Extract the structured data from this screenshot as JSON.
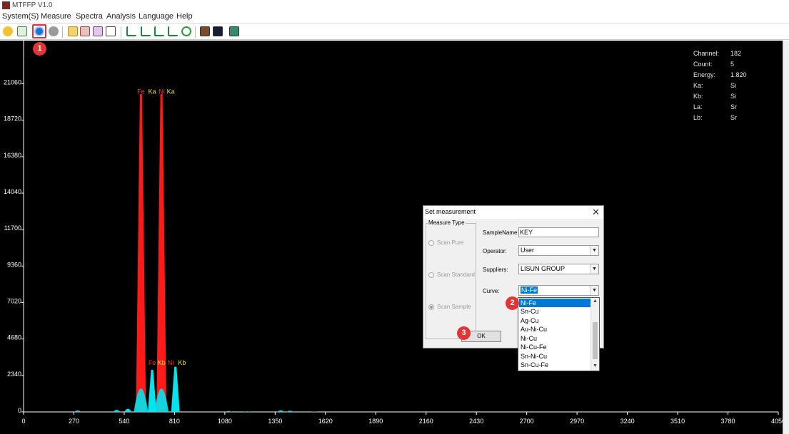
{
  "app": {
    "title": "MTFFP V1.0"
  },
  "menu": [
    "System(S)",
    "Measure",
    "Spectra",
    "Analysis",
    "Language",
    "Help"
  ],
  "toolbar_icons": [
    "smiley-icon",
    "move-icon",
    "start-measure-icon",
    "stop-icon",
    "open-folder-icon",
    "print-icon",
    "print-preview-icon",
    "report-icon",
    "peak-icon-1",
    "peak-icon-2",
    "peak-icon-3",
    "peak-icon-4",
    "refresh-icon",
    "palette-icon",
    "spectrum-view-icon",
    "export-icon"
  ],
  "badges": {
    "one": "1",
    "two": "2",
    "three": "3"
  },
  "chart_data": {
    "type": "line",
    "xlim": [
      0,
      4050
    ],
    "ylim": [
      0,
      22000
    ],
    "x_ticks": [
      0,
      270,
      540,
      810,
      1080,
      1350,
      1620,
      1890,
      2160,
      2430,
      2700,
      2970,
      3240,
      3510,
      3780,
      4050
    ],
    "y_ticks": [
      0,
      2340,
      4680,
      7020,
      9360,
      11700,
      14040,
      16380,
      18720,
      21060
    ],
    "peaks": [
      {
        "x": 630,
        "y": 20400,
        "color": "#ff1a1a"
      },
      {
        "x": 740,
        "y": 20400,
        "color": "#ff1a1a"
      },
      {
        "x": 690,
        "y": 2700,
        "color": "#00e5ee"
      },
      {
        "x": 815,
        "y": 2900,
        "color": "#00e5ee"
      }
    ],
    "peak_labels_top": [
      {
        "text": "Fe",
        "x": 630,
        "color": "#ff3030"
      },
      {
        "text": "Ka",
        "x": 690,
        "color": "#e8e030"
      },
      {
        "text": "Ni",
        "x": 742,
        "color": "#ff3030"
      },
      {
        "text": "Ka",
        "x": 790,
        "color": "#e8e030"
      }
    ],
    "peak_labels_low": [
      {
        "text": "Fe",
        "x": 690,
        "color": "#ff3030"
      },
      {
        "text": "Kb",
        "x": 740,
        "color": "#e8e030"
      },
      {
        "text": "Ni",
        "x": 790,
        "color": "#ff3030"
      },
      {
        "text": "Kb",
        "x": 850,
        "color": "#e8e030"
      }
    ],
    "line_color": "#00e5ee",
    "grid": false
  },
  "readout": [
    {
      "label": "Channel:",
      "value": "182"
    },
    {
      "label": "Count:",
      "value": "5"
    },
    {
      "label": "Energy:",
      "value": "1.820"
    },
    {
      "label": "Ka:",
      "value": "Si"
    },
    {
      "label": "Kb:",
      "value": "Si"
    },
    {
      "label": "La:",
      "value": "Sr"
    },
    {
      "label": "Lb:",
      "value": "Sr"
    }
  ],
  "dialog": {
    "title": "Set measurement",
    "group_label": "Measure Type",
    "radio_pure": "Scan Pure",
    "radio_standard": "Scan Standard",
    "radio_sample": "Scan Sample",
    "selected_radio": "Scan Sample",
    "sample_name_label": "SampleName",
    "sample_name_value": "KEY",
    "operator_label": "Operator:",
    "operator_value": "User",
    "suppliers_label": "Suppliers:",
    "suppliers_value": "LISUN GROUP",
    "curve_label": "Curve:",
    "curve_value": "Ni-Fe",
    "ok_label": "OK",
    "curve_options": [
      "Ni-Fe",
      "Sn-Cu",
      "Ag-Cu",
      "Au-Ni-Cu",
      "Ni-Cu",
      "Ni-Cu-Fe",
      "Sn-Ni-Cu",
      "Sn-Cu-Fe"
    ]
  }
}
